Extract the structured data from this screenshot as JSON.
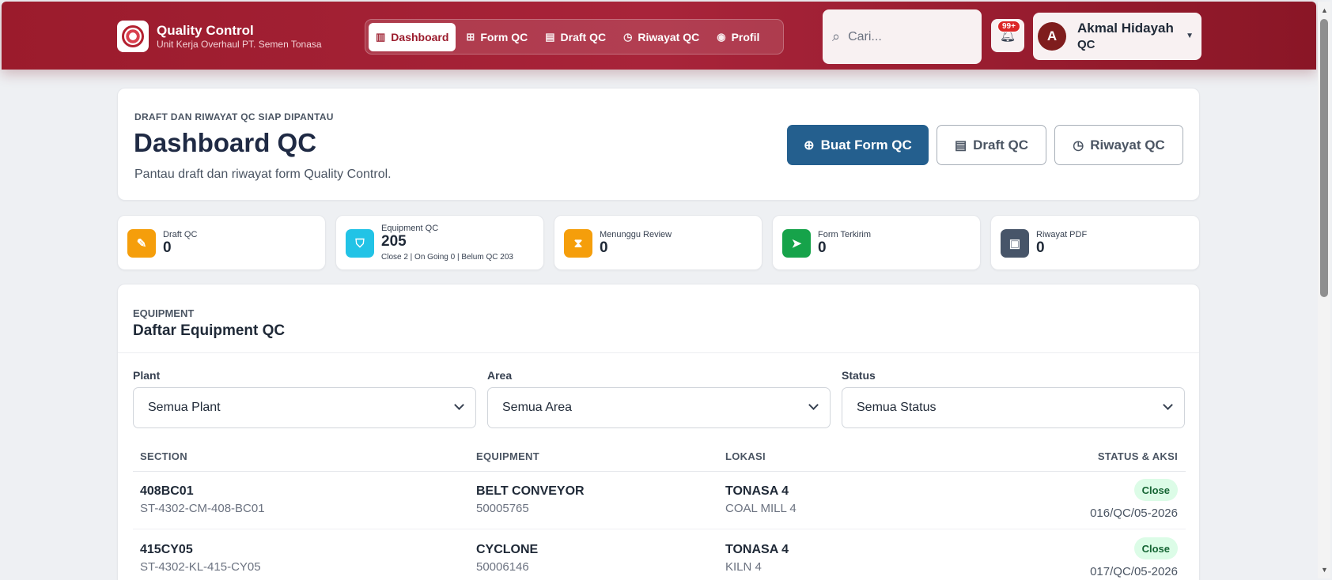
{
  "brand": {
    "title": "Quality Control",
    "subtitle": "Unit Kerja Overhaul PT. Semen Tonasa"
  },
  "nav": {
    "items": [
      {
        "label": "Dashboard",
        "icon": "dashboard-icon",
        "active": true
      },
      {
        "label": "Form QC",
        "icon": "grid-icon",
        "active": false
      },
      {
        "label": "Draft QC",
        "icon": "document-icon",
        "active": false
      },
      {
        "label": "Riwayat QC",
        "icon": "clock-icon",
        "active": false
      },
      {
        "label": "Profil",
        "icon": "user-circle-icon",
        "active": false
      }
    ]
  },
  "search": {
    "placeholder": "Cari..."
  },
  "notifications": {
    "badge": "99+"
  },
  "user": {
    "initial": "A",
    "name": "Akmal Hidayah",
    "role": "QC"
  },
  "hero": {
    "kicker": "DRAFT DAN RIWAYAT QC SIAP DIPANTAU",
    "title": "Dashboard QC",
    "description": "Pantau draft dan riwayat form Quality Control.",
    "actions": {
      "create": "Buat Form QC",
      "draft": "Draft QC",
      "history": "Riwayat QC"
    }
  },
  "stats": [
    {
      "label": "Draft QC",
      "value": "0",
      "icon": "edit-icon",
      "color": "#f59e0b"
    },
    {
      "label": "Equipment QC",
      "value": "205",
      "sub": "Close 2 | On Going 0 | Belum QC 203",
      "icon": "shield-icon",
      "color": "#22c3e6"
    },
    {
      "label": "Menunggu Review",
      "value": "0",
      "icon": "hourglass-icon",
      "color": "#f59e0b"
    },
    {
      "label": "Form Terkirim",
      "value": "0",
      "icon": "send-icon",
      "color": "#16a34a"
    },
    {
      "label": "Riwayat PDF",
      "value": "0",
      "icon": "pdf-icon",
      "color": "#475569"
    }
  ],
  "equipment": {
    "kicker": "EQUIPMENT",
    "title": "Daftar Equipment QC",
    "filters": {
      "plant": {
        "label": "Plant",
        "value": "Semua Plant"
      },
      "area": {
        "label": "Area",
        "value": "Semua Area"
      },
      "status": {
        "label": "Status",
        "value": "Semua Status"
      }
    },
    "columns": {
      "section": "SECTION",
      "equipment": "EQUIPMENT",
      "location": "LOKASI",
      "status": "STATUS & AKSI"
    },
    "rows": [
      {
        "section": "408BC01",
        "section_code": "ST-4302-CM-408-BC01",
        "equipment": "BELT CONVEYOR",
        "equipment_no": "50005765",
        "location": "TONASA 4",
        "sublocation": "COAL MILL 4",
        "status": "Close",
        "doc_no": "016/QC/05-2026"
      },
      {
        "section": "415CY05",
        "section_code": "ST-4302-KL-415-CY05",
        "equipment": "CYCLONE",
        "equipment_no": "50006146",
        "location": "TONASA 4",
        "sublocation": "KILN 4",
        "status": "Close",
        "doc_no": "017/QC/05-2026"
      }
    ]
  }
}
